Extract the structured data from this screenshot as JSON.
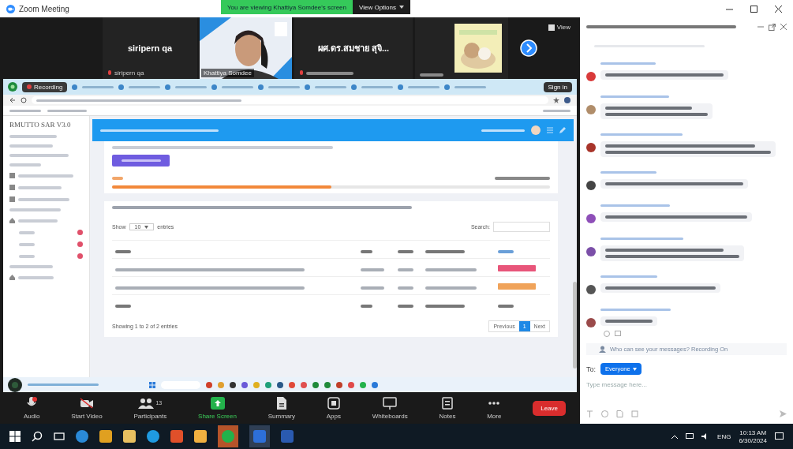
{
  "window": {
    "title": "Zoom Meeting"
  },
  "share_banner": {
    "text": "You are viewing Khattiya Somdee's screen",
    "options": "View Options"
  },
  "video_strip": {
    "view_label": "View",
    "tiles": [
      {
        "kind": "name",
        "big_name": "siripern qa",
        "name": "siripern qa"
      },
      {
        "kind": "video",
        "name": "Khattiya Somdee"
      },
      {
        "kind": "name",
        "big_name": "ผศ.ดร.สมชาย สุจิ..."
      },
      {
        "kind": "picture"
      }
    ]
  },
  "browser": {
    "recording": "Recording",
    "sign_in": "Sign in"
  },
  "web_app": {
    "brand": "RMUTTO SAR V3.0",
    "progress": {
      "level": 0.5
    },
    "table": {
      "show_label": "Show",
      "page_size": "10",
      "entries_label": "entries",
      "search_label": "Search:",
      "rows": [
        {
          "color": "#e8557a"
        },
        {
          "color": "#f0a35a"
        }
      ],
      "info": "Showing 1 to 2 of 2 entries",
      "pagination": [
        {
          "label": "Previous",
          "selected": false
        },
        {
          "label": "1",
          "selected": true
        },
        {
          "label": "Next",
          "selected": false
        }
      ]
    }
  },
  "toolbar": [
    {
      "kind": "audio",
      "label": "Audio"
    },
    {
      "kind": "video",
      "label": "Start Video"
    },
    {
      "kind": "participants",
      "label": "Participants",
      "count": "13"
    },
    {
      "kind": "share",
      "label": "Share Screen"
    },
    {
      "kind": "summary",
      "label": "Summary"
    },
    {
      "kind": "apps",
      "label": "Apps"
    },
    {
      "kind": "whiteboards",
      "label": "Whiteboards"
    },
    {
      "kind": "notes",
      "label": "Notes"
    },
    {
      "kind": "more",
      "label": "More"
    },
    {
      "kind": "leave",
      "label": "Leave"
    }
  ],
  "chat": {
    "messages": [
      {
        "kind": "one-line",
        "color": "#d93a3a"
      },
      {
        "kind": "two-line",
        "color": "#b08d6a"
      },
      {
        "kind": "two-line",
        "color": "#a8342a"
      },
      {
        "kind": "one-line",
        "color": "#444444"
      },
      {
        "kind": "one-line",
        "color": "#8e4fb8"
      },
      {
        "kind": "two-line",
        "color": "#7b4fa8"
      },
      {
        "kind": "one-line",
        "color": "#555555"
      },
      {
        "kind": "one-line",
        "color": "#9a4a4a"
      }
    ],
    "notice": "Who can see your messages? Recording On",
    "to_label": "To:",
    "recipient": "Everyone",
    "placeholder": "Type message here..."
  },
  "taskbar": {
    "language": "ENG",
    "time": "10:13 AM",
    "date": "6/30/2024"
  }
}
